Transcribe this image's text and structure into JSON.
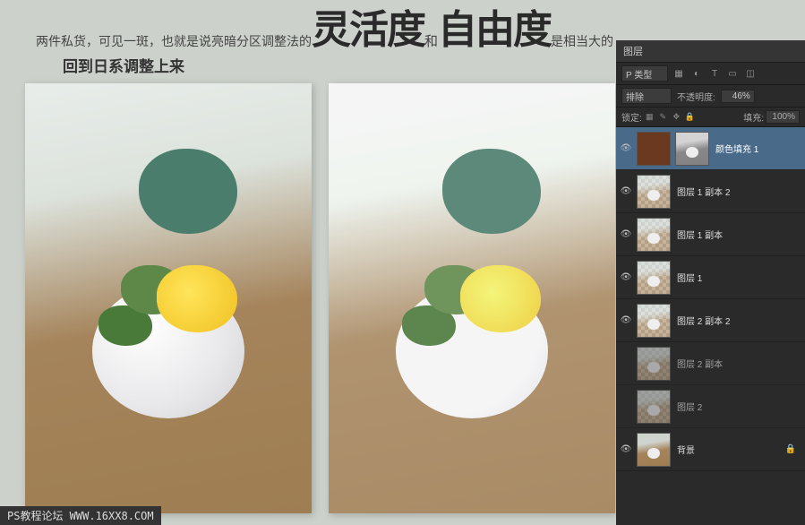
{
  "header": {
    "line1_a": "两件私货，可见一斑，也就是说亮暗分区调整法的",
    "big1": "灵活度",
    "mid": "和",
    "big2": "自由度",
    "line1_b": "是相当大的",
    "line2": "回到日系调整上来"
  },
  "panel": {
    "tab": "图层",
    "kind": "P 类型",
    "blend": "排除",
    "opacity_label": "不透明度:",
    "opacity_value": "46%",
    "lock_label": "锁定:",
    "fill_label": "填充:",
    "fill_value": "100%"
  },
  "layers": [
    {
      "name": "颜色填充 1",
      "sel": true,
      "type": "colorfill",
      "eye": true
    },
    {
      "name": "图层 1 副本 2",
      "type": "trans",
      "eye": true
    },
    {
      "name": "图层 1 副本",
      "type": "trans",
      "eye": true
    },
    {
      "name": "图层 1",
      "type": "trans",
      "eye": true
    },
    {
      "name": "图层 2 副本 2",
      "type": "trans",
      "eye": true
    },
    {
      "name": "图层 2 副本",
      "type": "trans",
      "eye": false
    },
    {
      "name": "图层 2",
      "type": "trans",
      "eye": false
    },
    {
      "name": "背景",
      "type": "bg",
      "eye": true,
      "lock": true
    }
  ],
  "footer": "PS教程论坛 WWW.16XX8.COM"
}
